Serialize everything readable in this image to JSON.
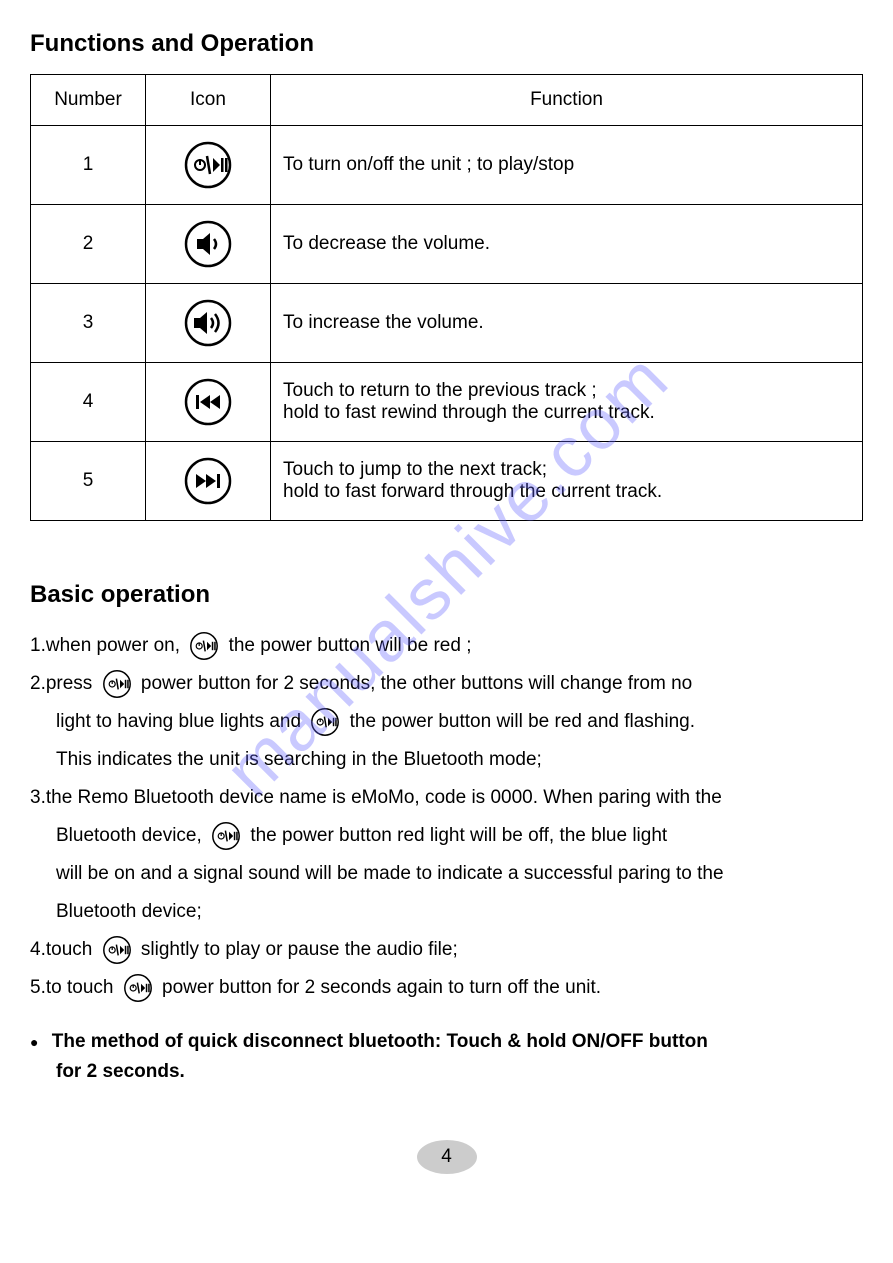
{
  "section1_title": "Functions and Operation",
  "table_headers": {
    "number": "Number",
    "icon": "Icon",
    "function": "Function"
  },
  "rows": [
    {
      "num": "1",
      "icon": "power-play-icon",
      "func": "To turn on/off the unit ; to play/stop"
    },
    {
      "num": "2",
      "icon": "volume-down-icon",
      "func": "To decrease the volume."
    },
    {
      "num": "3",
      "icon": "volume-up-icon",
      "func": "To increase the volume."
    },
    {
      "num": "4",
      "icon": "prev-track-icon",
      "func": "Touch to return to the previous track ;\nhold to fast rewind through the current track."
    },
    {
      "num": "5",
      "icon": "next-track-icon",
      "func": "Touch to jump to the next track;\nhold to fast forward through the current track."
    }
  ],
  "section2_title": "Basic operation",
  "op": {
    "line1a": "1.when power on,",
    "line1b": "the power button will be red ;",
    "line2a": "2.press",
    "line2b": "power button for 2 seconds, the other buttons will change from no",
    "line2c": "light to having blue lights and",
    "line2d": "the power button will be red and flashing.",
    "line2e": "This indicates the unit is searching in the Bluetooth mode;",
    "line3a": "3.the Remo Bluetooth device name is eMoMo, code is 0000. When paring with the",
    "line3b": "Bluetooth device,",
    "line3c": "the power button red light will be off,  the blue light",
    "line3d": "will be on and a signal sound will be made to indicate a successful paring to the",
    "line3e": "Bluetooth device;",
    "line4a": "4.touch",
    "line4b": "slightly to play or pause the audio file;",
    "line5a": "5.to touch",
    "line5b": "power button for 2 seconds again to turn off the unit."
  },
  "bullet1": "The method of quick disconnect bluetooth: Touch & hold ON/OFF button",
  "bullet1_cont": "for 2 seconds.",
  "page_number": "4",
  "watermark": "manualshive.com"
}
